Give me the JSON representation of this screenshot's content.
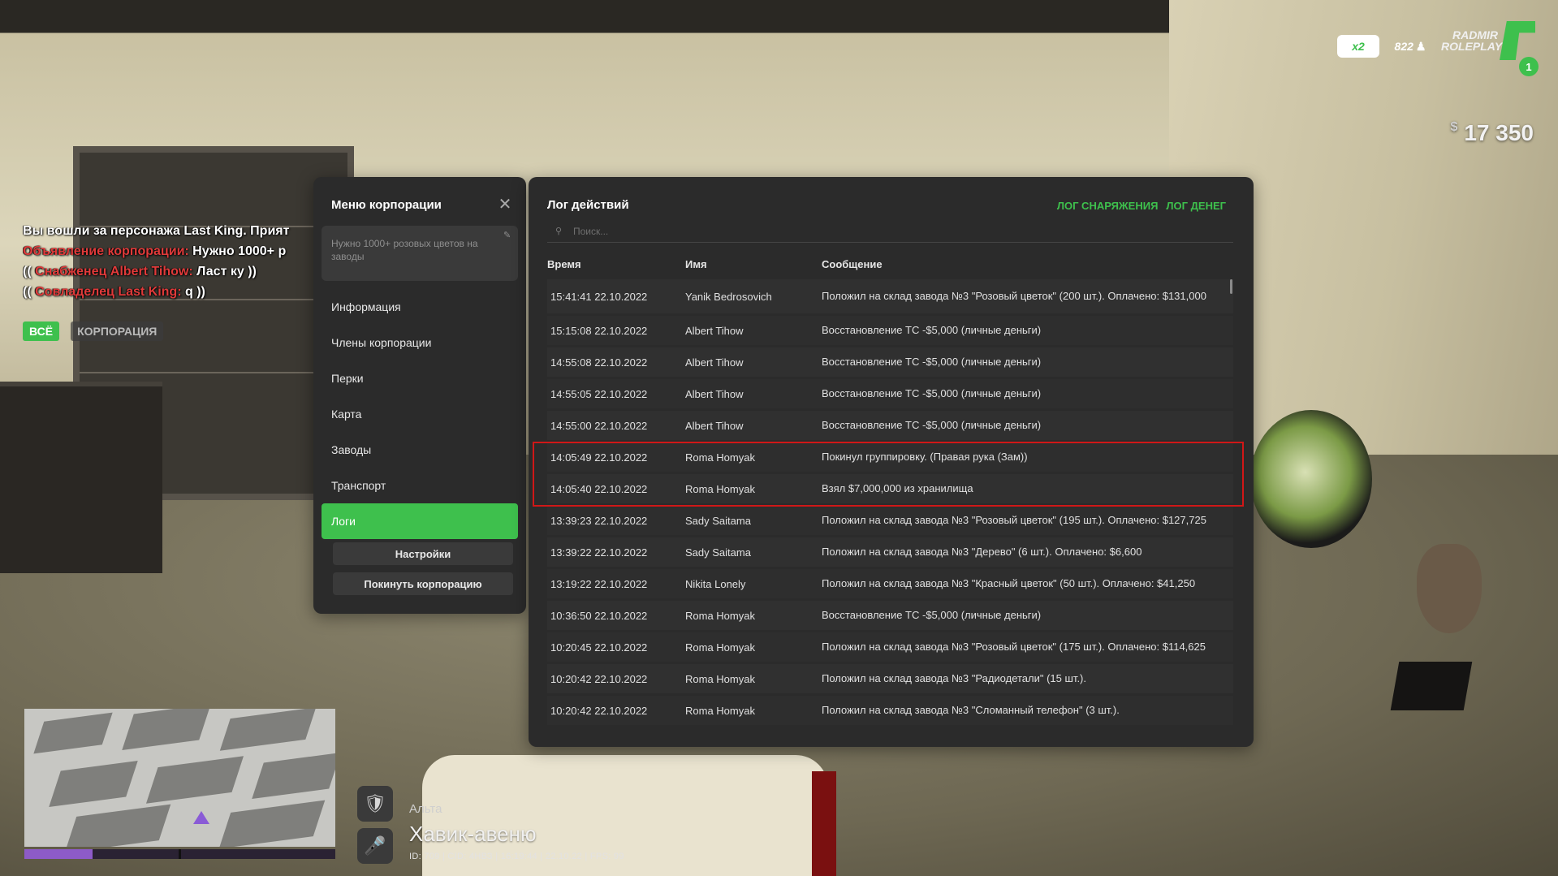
{
  "hud": {
    "badge_x2": "x2",
    "badge_822": "822",
    "logo_line1": "RADMIR",
    "logo_line2": "ROLEPLAY",
    "server_number": "1",
    "money_currency": "$",
    "money_value": "17 350"
  },
  "chat": {
    "lines": [
      {
        "prefix": "",
        "name": "",
        "text": "Вы вошли за персонажа Last King. Прият"
      },
      {
        "prefix": "",
        "name": "Объявление корпорации:",
        "text": " Нужно 1000+ р"
      },
      {
        "prefix": "(( ",
        "name": "Снабженец Albert Tihow:",
        "text": " Ласт ку ))"
      },
      {
        "prefix": "(( ",
        "name": "Совладелец Last King:",
        "text": " q ))"
      }
    ],
    "tab_all": "ВСЁ",
    "tab_corp": "КОРПОРАЦИЯ"
  },
  "corp_menu": {
    "title": "Меню корпорации",
    "note": "Нужно 1000+ розовых цветов на заводы",
    "nav": [
      {
        "label": "Информация",
        "active": false
      },
      {
        "label": "Члены корпорации",
        "active": false
      },
      {
        "label": "Перки",
        "active": false
      },
      {
        "label": "Карта",
        "active": false
      },
      {
        "label": "Заводы",
        "active": false
      },
      {
        "label": "Транспорт",
        "active": false
      },
      {
        "label": "Логи",
        "active": true
      }
    ],
    "settings_button": "Настройки",
    "leave_button": "Покинуть корпорацию"
  },
  "log": {
    "title": "Лог действий",
    "link_equipment": "ЛОГ СНАРЯЖЕНИЯ",
    "link_money": "ЛОГ ДЕНЕГ",
    "search_placeholder": "Поиск...",
    "columns": {
      "time": "Время",
      "name": "Имя",
      "message": "Сообщение"
    },
    "rows": [
      {
        "time": "15:41:41 22.10.2022",
        "name": "Yanik Bedrosovich",
        "message": "Положил на склад завода №3 \"Розовый цветок\" (200 шт.). Оплачено: $131,000"
      },
      {
        "time": "15:15:08 22.10.2022",
        "name": "Albert Tihow",
        "message": "Восстановление ТС -$5,000 (личные деньги)"
      },
      {
        "time": "14:55:08 22.10.2022",
        "name": "Albert Tihow",
        "message": "Восстановление ТС -$5,000 (личные деньги)"
      },
      {
        "time": "14:55:05 22.10.2022",
        "name": "Albert Tihow",
        "message": "Восстановление ТС -$5,000 (личные деньги)"
      },
      {
        "time": "14:55:00 22.10.2022",
        "name": "Albert Tihow",
        "message": "Восстановление ТС -$5,000 (личные деньги)"
      },
      {
        "time": "14:05:49 22.10.2022",
        "name": "Roma Homyak",
        "message": "Покинул группировку. (Правая рука (Зам))"
      },
      {
        "time": "14:05:40 22.10.2022",
        "name": "Roma Homyak",
        "message": "Взял $7,000,000 из хранилища"
      },
      {
        "time": "13:39:23 22.10.2022",
        "name": "Sady Saitama",
        "message": "Положил на склад завода №3 \"Розовый цветок\" (195 шт.). Оплачено: $127,725"
      },
      {
        "time": "13:39:22 22.10.2022",
        "name": "Sady Saitama",
        "message": "Положил на склад завода №3 \"Дерево\" (6 шт.). Оплачено: $6,600"
      },
      {
        "time": "13:19:22 22.10.2022",
        "name": "Nikita Lonely",
        "message": "Положил на склад завода №3 \"Красный цветок\" (50 шт.). Оплачено: $41,250"
      },
      {
        "time": "10:36:50 22.10.2022",
        "name": "Roma Homyak",
        "message": "Восстановление ТС -$5,000 (личные деньги)"
      },
      {
        "time": "10:20:45 22.10.2022",
        "name": "Roma Homyak",
        "message": "Положил на склад завода №3 \"Розовый цветок\" (175 шт.). Оплачено: $114,625"
      },
      {
        "time": "10:20:42 22.10.2022",
        "name": "Roma Homyak",
        "message": "Положил на склад завода №3 \"Радиодетали\" (15 шт.)."
      },
      {
        "time": "10:20:42 22.10.2022",
        "name": "Roma Homyak",
        "message": "Положил на склад завода №3 \"Сломанный телефон\" (3 шт.)."
      }
    ]
  },
  "location": {
    "zone": "Альта",
    "street": "Хавик-авеню",
    "info": "ID: 709 | CID: 4НВЗ | 16:19:44 | 22.10.22 | FPS: 99"
  },
  "minimap": {
    "progress": 0.22
  },
  "colors": {
    "accent": "#3ec04d",
    "highlight": "#d01717",
    "panel": "#2b2b2b"
  },
  "icons": {
    "close": "close-icon",
    "edit": "edit-icon",
    "search": "search-icon",
    "shield": "shield-icon",
    "mic": "microphone-icon"
  }
}
